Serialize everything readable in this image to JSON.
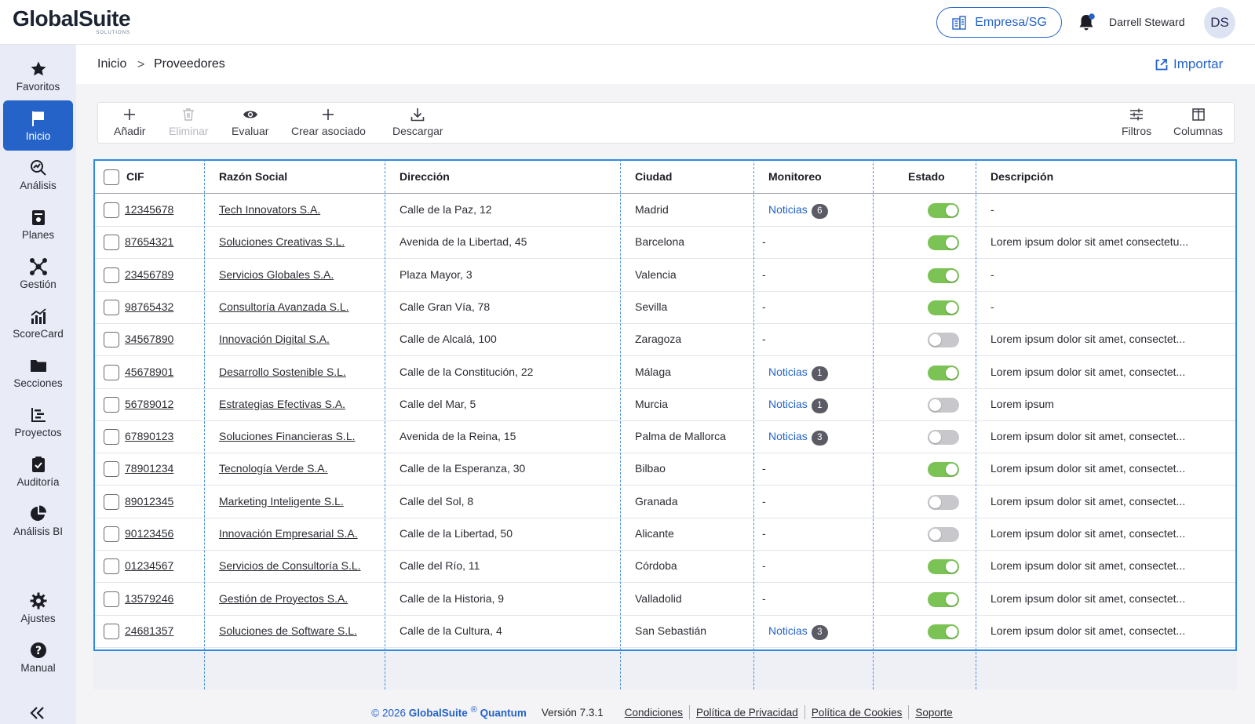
{
  "header": {
    "logo": "GlobalSuite",
    "logo_sub": "SOLUTIONS",
    "company": "Empresa/SG",
    "user_name": "Darrell Steward",
    "avatar": "DS"
  },
  "sidebar": {
    "items": [
      {
        "label": "Favoritos",
        "icon": "star-icon"
      },
      {
        "label": "Inicio",
        "icon": "flag-icon",
        "active": true
      },
      {
        "label": "Análisis",
        "icon": "analysis-icon"
      },
      {
        "label": "Planes",
        "icon": "plans-icon"
      },
      {
        "label": "Gestión",
        "icon": "management-icon"
      },
      {
        "label": "ScoreCard",
        "icon": "chart-bars-icon"
      },
      {
        "label": "Secciones",
        "icon": "folder-icon"
      },
      {
        "label": "Proyectos",
        "icon": "gantt-icon"
      },
      {
        "label": "Auditoría",
        "icon": "clipboard-check-icon"
      },
      {
        "label": "Análisis BI",
        "icon": "pie-icon"
      },
      {
        "label": "Ajustes",
        "icon": "gear-icon"
      },
      {
        "label": "Manual",
        "icon": "help-icon"
      }
    ]
  },
  "breadcrumb": {
    "home": "Inicio",
    "separator": ">",
    "current": "Proveedores"
  },
  "import_label": "Importar",
  "toolbar": {
    "add": "Añadir",
    "delete": "Eliminar",
    "evaluate": "Evaluar",
    "create_associated": "Crear asociado",
    "download": "Descargar",
    "filters": "Filtros",
    "columns": "Columnas"
  },
  "table": {
    "columns": [
      "CIF",
      "Razón Social",
      "Dirección",
      "Ciudad",
      "Monitoreo",
      "Estado",
      "Descripción"
    ],
    "news_label": "Noticias",
    "rows": [
      {
        "cif": "12345678",
        "name": "Tech Innovators S.A.",
        "address": "Calle de la Paz, 12",
        "city": "Madrid",
        "news": 6,
        "active": true,
        "desc": "-"
      },
      {
        "cif": "87654321",
        "name": "Soluciones Creativas S.L.",
        "address": "Avenida de la Libertad, 45",
        "city": "Barcelona",
        "news": null,
        "active": true,
        "desc": "Lorem ipsum dolor sit amet consectetu..."
      },
      {
        "cif": "23456789",
        "name": "Servicios Globales S.A.",
        "address": "Plaza Mayor, 3",
        "city": "Valencia",
        "news": null,
        "active": true,
        "desc": "-"
      },
      {
        "cif": "98765432",
        "name": "Consultoría Avanzada S.L.",
        "address": "Calle Gran Vía, 78",
        "city": "Sevilla",
        "news": null,
        "active": true,
        "desc": "-"
      },
      {
        "cif": "34567890",
        "name": "Innovación Digital S.A.",
        "address": "Calle de Alcalá, 100",
        "city": "Zaragoza",
        "news": null,
        "active": false,
        "desc": "Lorem ipsum dolor sit amet, consectet..."
      },
      {
        "cif": "45678901",
        "name": "Desarrollo Sostenible S.L.",
        "address": "Calle de la Constitución, 22",
        "city": "Málaga",
        "news": 1,
        "active": true,
        "desc": "Lorem ipsum dolor sit amet, consectet..."
      },
      {
        "cif": "56789012",
        "name": "Estrategias Efectivas S.A.",
        "address": "Calle del Mar, 5",
        "city": "Murcia",
        "news": 1,
        "active": false,
        "desc": "Lorem ipsum"
      },
      {
        "cif": "67890123",
        "name": "Soluciones Financieras S.L.",
        "address": "Avenida de la Reina, 15",
        "city": "Palma de Mallorca",
        "news": 3,
        "active": false,
        "desc": "Lorem ipsum dolor sit amet, consectet..."
      },
      {
        "cif": "78901234",
        "name": "Tecnología Verde S.A.",
        "address": "Calle de la Esperanza, 30",
        "city": "Bilbao",
        "news": null,
        "active": true,
        "desc": "Lorem ipsum dolor sit amet, consectet..."
      },
      {
        "cif": "89012345",
        "name": "Marketing Inteligente S.L.",
        "address": "Calle del Sol, 8",
        "city": "Granada",
        "news": null,
        "active": false,
        "desc": "Lorem ipsum dolor sit amet, consectet..."
      },
      {
        "cif": "90123456",
        "name": "Innovación Empresarial S.A.",
        "address": "Calle de la Libertad, 50",
        "city": "Alicante",
        "news": null,
        "active": false,
        "desc": "Lorem ipsum dolor sit amet, consectet..."
      },
      {
        "cif": "01234567",
        "name": "Servicios de Consultoría S.L.",
        "address": "Calle del Río, 11",
        "city": "Córdoba",
        "news": null,
        "active": true,
        "desc": "Lorem ipsum dolor sit amet, consectet..."
      },
      {
        "cif": "13579246",
        "name": "Gestión de Proyectos S.A.",
        "address": "Calle de la Historia, 9",
        "city": "Valladolid",
        "news": null,
        "active": true,
        "desc": "Lorem ipsum dolor sit amet, consectet..."
      },
      {
        "cif": "24681357",
        "name": "Soluciones de Software S.L.",
        "address": "Calle de la Cultura, 4",
        "city": "San Sebastián",
        "news": 3,
        "active": true,
        "desc": "Lorem ipsum dolor sit amet, consectet..."
      }
    ]
  },
  "footer": {
    "copyright": "© 2026",
    "brand": "GlobalSuite",
    "reg": "®",
    "product": "Quantum",
    "version": "Versión 7.3.1",
    "links": [
      "Condiciones",
      "Política de Privacidad",
      "Política de Cookies",
      "Soporte"
    ]
  },
  "colors": {
    "accent": "#2563c9",
    "toggle_on": "#7cc356",
    "toggle_off": "#c8c8cc",
    "sidebar_bg": "#e9ecf7",
    "selection_border": "#2c8be0"
  }
}
